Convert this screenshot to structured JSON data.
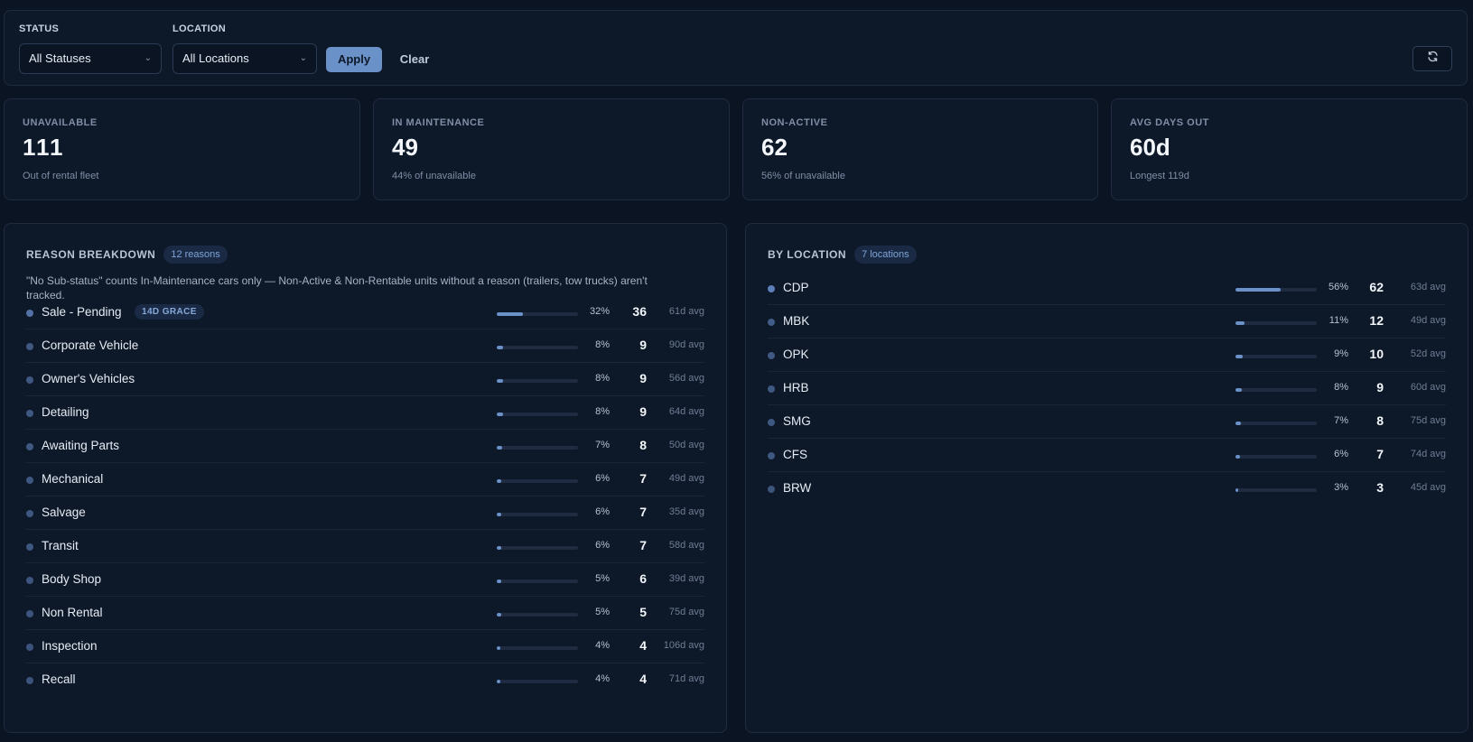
{
  "filters": {
    "status_label": "STATUS",
    "status_value": "All Statuses",
    "location_label": "LOCATION",
    "location_value": "All Locations",
    "apply_label": "Apply",
    "clear_label": "Clear"
  },
  "stats": [
    {
      "label": "UNAVAILABLE",
      "value": "111",
      "sub": "Out of rental fleet"
    },
    {
      "label": "IN MAINTENANCE",
      "value": "49",
      "sub": "44% of unavailable"
    },
    {
      "label": "NON-ACTIVE",
      "value": "62",
      "sub": "56% of unavailable"
    },
    {
      "label": "AVG DAYS OUT",
      "value": "60d",
      "sub": "Longest 119d"
    }
  ],
  "reason_breakdown": {
    "title": "REASON BREAKDOWN",
    "badge": "12 reasons",
    "note": "\"No Sub-status\" counts In-Maintenance cars only — Non-Active & Non-Rentable units without a reason (trailers, tow trucks) aren't tracked.",
    "grace_badge": "14D GRACE",
    "rows": [
      {
        "name": "Sale - Pending",
        "pct": "32%",
        "count": "36",
        "avg": "61d avg",
        "share": 0.32
      },
      {
        "name": "Corporate Vehicle",
        "pct": "8%",
        "count": "9",
        "avg": "90d avg",
        "share": 0.08
      },
      {
        "name": "Owner's Vehicles",
        "pct": "8%",
        "count": "9",
        "avg": "56d avg",
        "share": 0.08
      },
      {
        "name": "Detailing",
        "pct": "8%",
        "count": "9",
        "avg": "64d avg",
        "share": 0.08
      },
      {
        "name": "Awaiting Parts",
        "pct": "7%",
        "count": "8",
        "avg": "50d avg",
        "share": 0.07
      },
      {
        "name": "Mechanical",
        "pct": "6%",
        "count": "7",
        "avg": "49d avg",
        "share": 0.06
      },
      {
        "name": "Salvage",
        "pct": "6%",
        "count": "7",
        "avg": "35d avg",
        "share": 0.06
      },
      {
        "name": "Transit",
        "pct": "6%",
        "count": "7",
        "avg": "58d avg",
        "share": 0.06
      },
      {
        "name": "Body Shop",
        "pct": "5%",
        "count": "6",
        "avg": "39d avg",
        "share": 0.05
      },
      {
        "name": "Non Rental",
        "pct": "5%",
        "count": "5",
        "avg": "75d avg",
        "share": 0.05
      },
      {
        "name": "Inspection",
        "pct": "4%",
        "count": "4",
        "avg": "106d avg",
        "share": 0.04
      },
      {
        "name": "Recall",
        "pct": "4%",
        "count": "4",
        "avg": "71d avg",
        "share": 0.04
      }
    ]
  },
  "by_location": {
    "title": "BY LOCATION",
    "badge": "7 locations",
    "rows": [
      {
        "name": "CDP",
        "pct": "56%",
        "count": "62",
        "avg": "63d avg",
        "share": 0.56
      },
      {
        "name": "MBK",
        "pct": "11%",
        "count": "12",
        "avg": "49d avg",
        "share": 0.11
      },
      {
        "name": "OPK",
        "pct": "9%",
        "count": "10",
        "avg": "52d avg",
        "share": 0.09
      },
      {
        "name": "HRB",
        "pct": "8%",
        "count": "9",
        "avg": "60d avg",
        "share": 0.08
      },
      {
        "name": "SMG",
        "pct": "7%",
        "count": "8",
        "avg": "75d avg",
        "share": 0.07
      },
      {
        "name": "CFS",
        "pct": "6%",
        "count": "7",
        "avg": "74d avg",
        "share": 0.06
      },
      {
        "name": "BRW",
        "pct": "3%",
        "count": "3",
        "avg": "45d avg",
        "share": 0.03
      }
    ]
  },
  "colors": {
    "accent": "#6b91c9",
    "background": "#0b1422",
    "panel": "#0d1828",
    "dot": "#5d7fb8"
  },
  "icons": {
    "refresh": "refresh-icon",
    "chevron": "chevron-down-icon"
  }
}
